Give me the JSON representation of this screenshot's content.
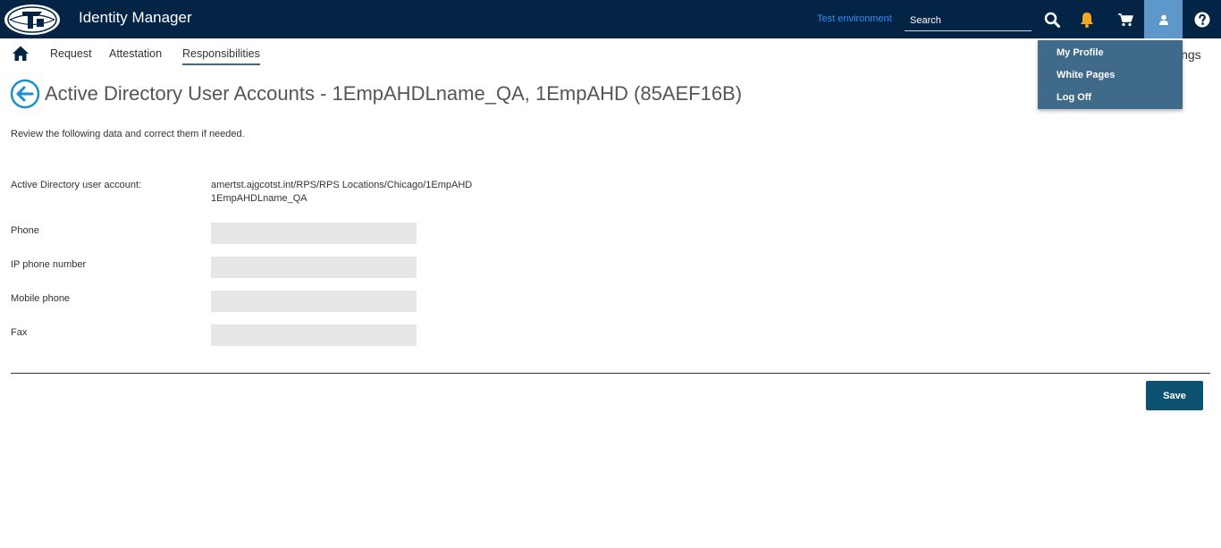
{
  "header": {
    "app_title": "Identity Manager",
    "environment": "Test environment",
    "search_placeholder": "Search",
    "icons": [
      "search-icon",
      "bell-icon",
      "cart-icon",
      "user-icon",
      "help-icon"
    ],
    "colors": {
      "bar": "#032444",
      "bell": "#f5a623",
      "env_link": "#2f8ff0",
      "user_active": "#5e97c9"
    }
  },
  "nav": {
    "items": [
      {
        "label": "Request"
      },
      {
        "label": "Attestation"
      },
      {
        "label": "Responsibilities"
      }
    ],
    "clipped_right": "ings"
  },
  "user_menu": {
    "items": [
      {
        "label": "My Profile"
      },
      {
        "label": "White Pages"
      },
      {
        "label": "Log Off"
      }
    ]
  },
  "page": {
    "title": "Active Directory User Accounts - 1EmpAHDLname_QA, 1EmpAHD (85AEF16B)",
    "intro": "Review the following data and correct them if needed."
  },
  "form": {
    "ad_account_label": "Active Directory user account:",
    "ad_account_value_line1": "amertst.ajgcotst.int/RPS/RPS Locations/Chicago/1EmpAHD",
    "ad_account_value_line2": "1EmpAHDLname_QA",
    "fields": [
      {
        "label": "Phone",
        "value": ""
      },
      {
        "label": "IP phone number",
        "value": ""
      },
      {
        "label": "Mobile phone",
        "value": ""
      },
      {
        "label": "Fax",
        "value": ""
      }
    ],
    "save_label": "Save"
  }
}
